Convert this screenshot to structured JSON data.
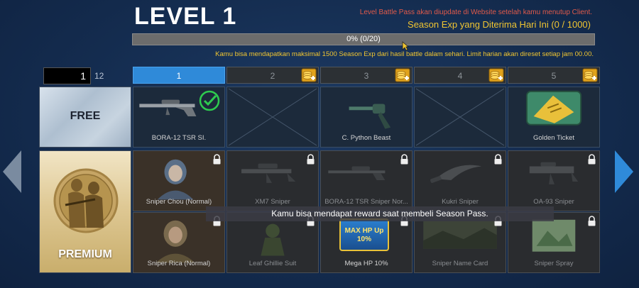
{
  "header": {
    "level_title": "LEVEL 1",
    "notice": "Level Battle Pass akan diupdate di Website setelah kamu menutup Client.",
    "season_exp": "Season Exp yang Diterima Hari Ini (0 / 1000)",
    "progress_text": "0% (0/20)",
    "progress_percent": 0,
    "limit_note": "Kamu bisa mendapatkan maksimal 1500 Season Exp dari hasil battle dalam sehari. Limit harian akan direset setiap jam 00.00."
  },
  "pager": {
    "current": "1",
    "total": "12"
  },
  "tabs": [
    {
      "label": "1",
      "active": true
    },
    {
      "label": "2",
      "icon": "coin-plus-icon"
    },
    {
      "label": "3",
      "icon": "coin-plus-icon"
    },
    {
      "label": "4",
      "icon": "coin-plus-icon"
    },
    {
      "label": "5",
      "icon": "coin-plus-icon"
    }
  ],
  "rows": {
    "free_label": "FREE",
    "premium_label": "PREMIUM"
  },
  "free_rewards": [
    {
      "name": "BORA-12 TSR SI.",
      "claimed": true
    },
    {
      "name": "",
      "empty": true
    },
    {
      "name": "C. Python Beast"
    },
    {
      "name": "",
      "empty": true
    },
    {
      "name": "Golden Ticket"
    }
  ],
  "premium_rewards_1": [
    {
      "name": "Sniper Chou (Normal)",
      "locked": true
    },
    {
      "name": "XM7 Sniper",
      "locked": true
    },
    {
      "name": "BORA-12 TSR Sniper Nor...",
      "locked": true
    },
    {
      "name": "Kukri Sniper",
      "locked": true
    },
    {
      "name": "OA-93 Sniper",
      "locked": true
    }
  ],
  "premium_rewards_2": [
    {
      "name": "Sniper Rica (Normal)",
      "locked": true
    },
    {
      "name": "Leaf Ghillie Suit",
      "locked": true
    },
    {
      "name": "Mega HP 10%",
      "locked": true,
      "art_text": "MAX HP Up 10%"
    },
    {
      "name": "Sniper Name Card",
      "locked": true
    },
    {
      "name": "Sniper Spray",
      "locked": true
    }
  ],
  "tooltip": "Kamu bisa mendapat reward saat membeli Season Pass.",
  "colors": {
    "accent_blue": "#2f8ad9",
    "gold": "#f0c531",
    "notice_red": "#e05a4a"
  }
}
